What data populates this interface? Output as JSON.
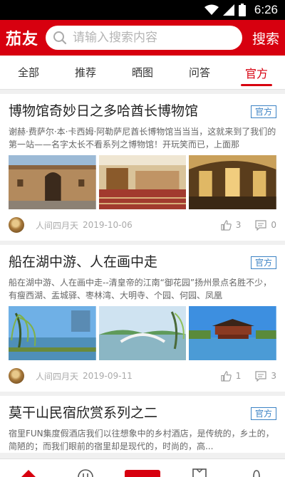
{
  "status_bar": {
    "time": "6:26"
  },
  "app": {
    "logo": "茄友",
    "search_placeholder": "请输入搜索内容",
    "search_button": "搜索"
  },
  "tabs": [
    {
      "label": "全部",
      "active": false
    },
    {
      "label": "推荐",
      "active": false
    },
    {
      "label": "晒图",
      "active": false
    },
    {
      "label": "问答",
      "active": false
    },
    {
      "label": "官方",
      "active": true
    }
  ],
  "articles": [
    {
      "title": "博物馆奇妙日之多哈酋长博物馆",
      "tag": "官方",
      "excerpt": "谢赫·费萨尔·本·卡西姆·阿勒萨尼酋长博物馆当当当，这就来到了我们的第一站——名字太长不看系列之博物馆！开玩笑而已，上面那",
      "author": "人间四月天",
      "date": "2019-10-06",
      "likes": "3",
      "comments": "0"
    },
    {
      "title": "船在湖中游、人在画中走",
      "tag": "官方",
      "excerpt": "船在湖中游、人在画中走--清皇帝的江南“御花园”扬州景点名胜不少，有瘦西湖、盂城驿、枣林湾、大明寺、个园、何园、凤凰",
      "author": "人间四月天",
      "date": "2019-09-11",
      "likes": "1",
      "comments": "3"
    },
    {
      "title": "莫干山民宿欣赏系列之二",
      "tag": "官方",
      "excerpt": "宿里FUN集度假酒店我们以往想象中的乡村酒店，是传统的，乡土的，简陋的；而我们眼前的宿里却是现代的，时尚的，高..."
    }
  ],
  "colors": {
    "brand": "#d7000f",
    "tag": "#3b82c4"
  }
}
